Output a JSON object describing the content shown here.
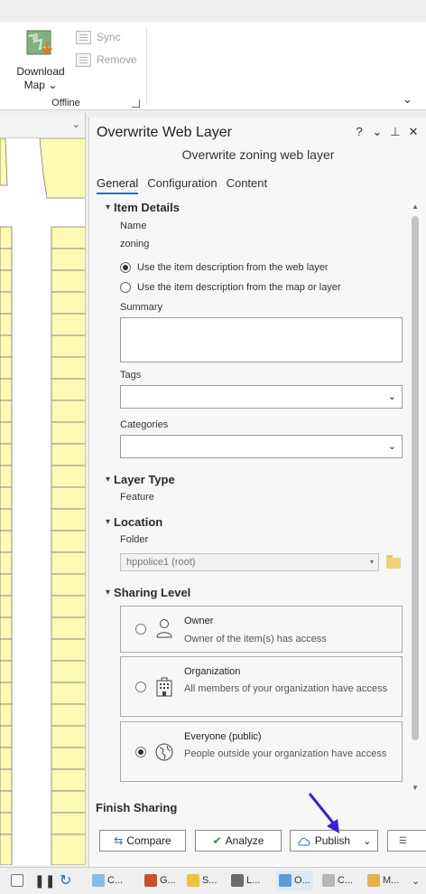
{
  "ribbon": {
    "download_map_label": "Download",
    "download_map_label2": "Map",
    "sync_label": "Sync",
    "remove_label": "Remove",
    "group_label": "Offline"
  },
  "pane": {
    "title": "Overwrite Web Layer",
    "subtitle": "Overwrite zoning web layer",
    "controls": [
      "?",
      "⌄",
      "⊥",
      "✕"
    ],
    "tabs": [
      "General",
      "Configuration",
      "Content"
    ],
    "active_tab": "General"
  },
  "item_details": {
    "heading": "Item Details",
    "name_label": "Name",
    "name_value": "zoning",
    "radio_web_layer": "Use the item description from the web layer",
    "radio_map_layer": "Use the item description from the map or layer",
    "summary_label": "Summary",
    "tags_label": "Tags",
    "categories_label": "Categories"
  },
  "layer_type": {
    "heading": "Layer Type",
    "value": "Feature"
  },
  "location": {
    "heading": "Location",
    "folder_label": "Folder",
    "folder_value": "hppolice1 (root)"
  },
  "sharing": {
    "heading": "Sharing Level",
    "owner_title": "Owner",
    "owner_desc": "Owner of the item(s) has access",
    "org_title": "Organization",
    "org_desc": "All members of your organization have access",
    "everyone_title": "Everyone (public)",
    "everyone_desc": "People outside your organization have access",
    "selected": "Everyone (public)"
  },
  "finish": {
    "heading": "Finish Sharing",
    "compare": "Compare",
    "analyze": "Analyze",
    "publish": "Publish"
  },
  "bottom_tabs": [
    "C...",
    "G...",
    "S...",
    "L...",
    "O...",
    "C...",
    "M..."
  ],
  "colors": {
    "accent": "#2f6fb5",
    "parcel_fill": "#fcfab4",
    "annotation_arrow": "#3b1fd6"
  }
}
